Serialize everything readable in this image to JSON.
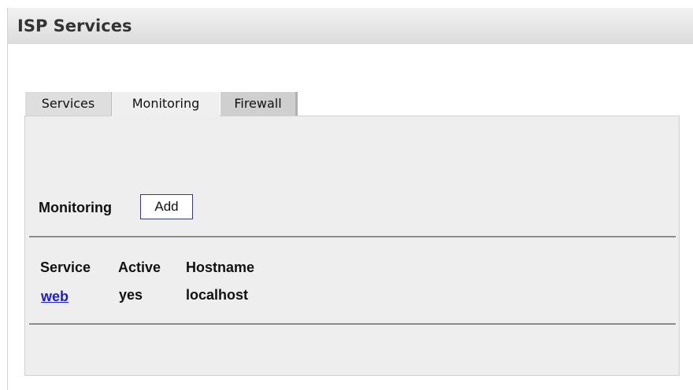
{
  "header": {
    "title": "ISP Services"
  },
  "tabs": [
    {
      "label": "Services",
      "active": false
    },
    {
      "label": "Monitoring",
      "active": true
    },
    {
      "label": "Firewall",
      "active": false
    }
  ],
  "monitoring": {
    "section_label": "Monitoring",
    "add_button_label": "Add",
    "table": {
      "columns": [
        "Service",
        "Active",
        "Hostname"
      ],
      "rows": [
        {
          "service": "web",
          "active": "yes",
          "hostname": "localhost"
        }
      ]
    }
  },
  "colors": {
    "link": "#1c1cd6",
    "panel_background": "#eeeeee",
    "header_gradient_top": "#f2f2f2",
    "header_gradient_bottom": "#dcdcdc"
  }
}
